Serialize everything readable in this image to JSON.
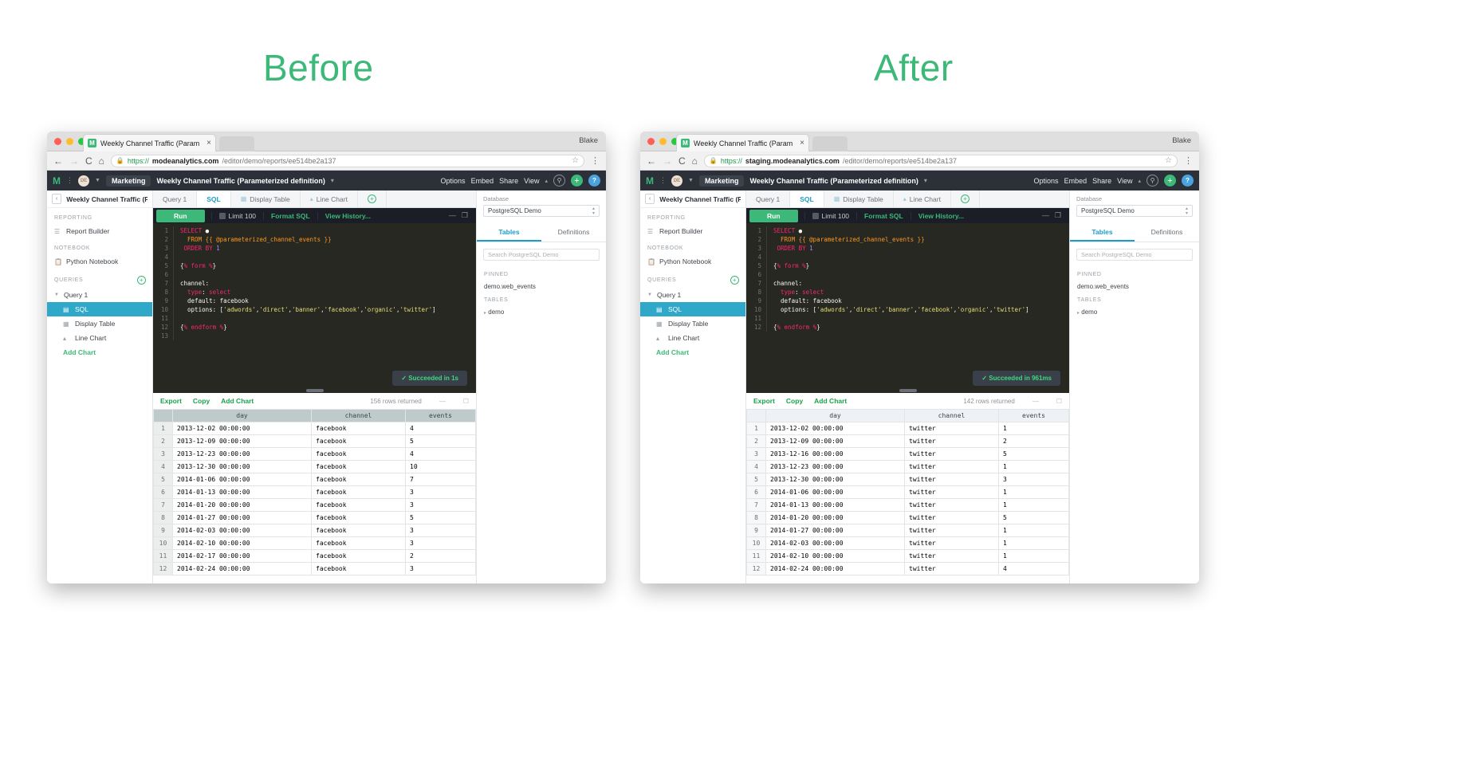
{
  "captions": {
    "before": "Before",
    "after": "After"
  },
  "before": {
    "browser": {
      "tab_title": "Weekly Channel Traffic (Param",
      "tab_close": "×",
      "tab_icon": "mode-logo-icon",
      "user": "Blake",
      "url_scheme": "https://",
      "url_domain": "modeanalytics.com",
      "url_path": "/editor/demo/reports/ee514be2a137",
      "back": "←",
      "forward": "→",
      "reload": "C",
      "home": "⌂",
      "lock": "🔒",
      "star": "☆",
      "menu": "⋮"
    },
    "appbar": {
      "logo": "M",
      "avatar_initials": "DE",
      "workspace": "Marketing",
      "report_title": "Weekly Channel Traffic (Parameterized definition)",
      "links": [
        "Options",
        "Embed",
        "Share",
        "View"
      ],
      "help": "?",
      "add": "+",
      "search_icon": "search-icon"
    },
    "sidebar": {
      "header": "Weekly Channel Traffic (P...",
      "sections": [
        {
          "label": "REPORTING",
          "items": [
            {
              "label": "Report Builder",
              "icon": "report-builder-icon"
            }
          ]
        },
        {
          "label": "NOTEBOOK",
          "items": [
            {
              "label": "Python Notebook",
              "icon": "notebook-icon"
            }
          ]
        },
        {
          "label": "QUERIES",
          "add": "+",
          "items": [
            {
              "label": "Query 1",
              "icon": "disclosure-icon"
            },
            {
              "label": "SQL",
              "icon": "sql-icon",
              "active": true
            },
            {
              "label": "Display Table",
              "icon": "table-icon"
            },
            {
              "label": "Line Chart",
              "icon": "chart-icon"
            },
            {
              "label": "Add Chart",
              "add": true
            }
          ]
        }
      ]
    },
    "editor_tabs": [
      {
        "label": "Query 1",
        "selected": false
      },
      {
        "label": "SQL",
        "selected": true
      },
      {
        "label": "Display Table",
        "icon": "table-icon"
      },
      {
        "label": "Line Chart",
        "icon": "chart-icon"
      },
      {
        "label": "+",
        "plus": true
      }
    ],
    "editor_toolbar": {
      "run": "Run",
      "limit": "Limit 100",
      "format": "Format SQL",
      "history": "View History...",
      "minimize": "—",
      "maximize": "❐"
    },
    "code": {
      "lines": [
        "1",
        "2",
        "3",
        "4",
        "5",
        "6",
        "7",
        "8",
        "9",
        "10",
        "11",
        "12",
        "13"
      ],
      "text": "SELECT *\n  FROM {{ @parameterized_channel_events }}\n ORDER BY 1\n\n{% form %}\n\nchannel:\n  type: select\n  default: facebook\n  options: ['adwords','direct','banner','facebook','organic','twitter']\n\n{% endform %}"
    },
    "toast": "✓  Succeeded in 1s",
    "results_bar": {
      "export": "Export",
      "copy": "Copy",
      "add_chart": "Add Chart",
      "count": "156 rows returned"
    },
    "table": {
      "columns": [
        "",
        "day",
        "channel",
        "events"
      ],
      "rows": [
        [
          "1",
          "2013-12-02 00:00:00",
          "facebook",
          "4"
        ],
        [
          "2",
          "2013-12-09 00:00:00",
          "facebook",
          "5"
        ],
        [
          "3",
          "2013-12-23 00:00:00",
          "facebook",
          "4"
        ],
        [
          "4",
          "2013-12-30 00:00:00",
          "facebook",
          "10"
        ],
        [
          "5",
          "2014-01-06 00:00:00",
          "facebook",
          "7"
        ],
        [
          "6",
          "2014-01-13 00:00:00",
          "facebook",
          "3"
        ],
        [
          "7",
          "2014-01-20 00:00:00",
          "facebook",
          "3"
        ],
        [
          "8",
          "2014-01-27 00:00:00",
          "facebook",
          "5"
        ],
        [
          "9",
          "2014-02-03 00:00:00",
          "facebook",
          "3"
        ],
        [
          "10",
          "2014-02-10 00:00:00",
          "facebook",
          "3"
        ],
        [
          "11",
          "2014-02-17 00:00:00",
          "facebook",
          "2"
        ],
        [
          "12",
          "2014-02-24 00:00:00",
          "facebook",
          "3"
        ]
      ]
    },
    "dbpanel": {
      "label": "Database",
      "selected": "PostgreSQL Demo",
      "tabs": [
        {
          "label": "Tables",
          "selected": true
        },
        {
          "label": "Definitions",
          "selected": false
        }
      ],
      "search_placeholder": "Search PostgreSQL Demo",
      "pinned_label": "PINNED",
      "pinned": [
        "demo.web_events"
      ],
      "tables_label": "TABLES",
      "tables": [
        "demo"
      ]
    }
  },
  "after": {
    "browser": {
      "tab_title": "Weekly Channel Traffic (Param",
      "tab_close": "×",
      "tab_icon": "mode-logo-icon",
      "user": "Blake",
      "url_scheme": "https://",
      "url_domain": "staging.modeanalytics.com",
      "url_path": "/editor/demo/reports/ee514be2a137",
      "back": "←",
      "forward": "→",
      "reload": "C",
      "home": "⌂",
      "lock": "🔒",
      "star": "☆",
      "menu": "⋮"
    },
    "appbar": {
      "logo": "M",
      "avatar_initials": "DE",
      "workspace": "Marketing",
      "report_title": "Weekly Channel Traffic (Parameterized definition)",
      "links": [
        "Options",
        "Embed",
        "Share",
        "View"
      ],
      "help": "?",
      "add": "+",
      "search_icon": "search-icon"
    },
    "sidebar": {
      "header": "Weekly Channel Traffic (P...",
      "sections": [
        {
          "label": "REPORTING",
          "items": [
            {
              "label": "Report Builder",
              "icon": "report-builder-icon"
            }
          ]
        },
        {
          "label": "NOTEBOOK",
          "items": [
            {
              "label": "Python Notebook",
              "icon": "notebook-icon"
            }
          ]
        },
        {
          "label": "QUERIES",
          "add": "+",
          "items": [
            {
              "label": "Query 1",
              "icon": "disclosure-icon"
            },
            {
              "label": "SQL",
              "icon": "sql-icon",
              "active": true
            },
            {
              "label": "Display Table",
              "icon": "table-icon"
            },
            {
              "label": "Line Chart",
              "icon": "chart-icon"
            },
            {
              "label": "Add Chart",
              "add": true
            }
          ]
        }
      ]
    },
    "editor_tabs": [
      {
        "label": "Query 1",
        "selected": false
      },
      {
        "label": "SQL",
        "selected": true
      },
      {
        "label": "Display Table",
        "icon": "table-icon"
      },
      {
        "label": "Line Chart",
        "icon": "chart-icon"
      },
      {
        "label": "+",
        "plus": true
      }
    ],
    "editor_toolbar": {
      "run": "Run",
      "limit": "Limit 100",
      "format": "Format SQL",
      "history": "View History...",
      "minimize": "—",
      "maximize": "❐"
    },
    "code": {
      "lines": [
        "1",
        "2",
        "3",
        "4",
        "5",
        "6",
        "7",
        "8",
        "9",
        "10",
        "11",
        "12"
      ],
      "text": "SELECT *\n  FROM {{ @parameterized_channel_events }}\n ORDER BY 1\n\n{% form %}\n\nchannel:\n  type: select\n  default: facebook\n  options: ['adwords','direct','banner','facebook','organic','twitter']\n\n{% endform %}"
    },
    "toast": "✓  Succeeded in 961ms",
    "results_bar": {
      "export": "Export",
      "copy": "Copy",
      "add_chart": "Add Chart",
      "count": "142 rows returned"
    },
    "table": {
      "columns": [
        "",
        "day",
        "channel",
        "events"
      ],
      "rows": [
        [
          "1",
          "2013-12-02 00:00:00",
          "twitter",
          "1"
        ],
        [
          "2",
          "2013-12-09 00:00:00",
          "twitter",
          "2"
        ],
        [
          "3",
          "2013-12-16 00:00:00",
          "twitter",
          "5"
        ],
        [
          "4",
          "2013-12-23 00:00:00",
          "twitter",
          "1"
        ],
        [
          "5",
          "2013-12-30 00:00:00",
          "twitter",
          "3"
        ],
        [
          "6",
          "2014-01-06 00:00:00",
          "twitter",
          "1"
        ],
        [
          "7",
          "2014-01-13 00:00:00",
          "twitter",
          "1"
        ],
        [
          "8",
          "2014-01-20 00:00:00",
          "twitter",
          "5"
        ],
        [
          "9",
          "2014-01-27 00:00:00",
          "twitter",
          "1"
        ],
        [
          "10",
          "2014-02-03 00:00:00",
          "twitter",
          "1"
        ],
        [
          "11",
          "2014-02-10 00:00:00",
          "twitter",
          "1"
        ],
        [
          "12",
          "2014-02-24 00:00:00",
          "twitter",
          "4"
        ]
      ]
    },
    "dbpanel": {
      "label": "Database",
      "selected": "PostgreSQL Demo",
      "tabs": [
        {
          "label": "Tables",
          "selected": true
        },
        {
          "label": "Definitions",
          "selected": false
        }
      ],
      "search_placeholder": "Search PostgreSQL Demo",
      "pinned_label": "PINNED",
      "pinned": [
        "demo.web_events"
      ],
      "tables_label": "TABLES",
      "tables": [
        "demo"
      ]
    }
  }
}
